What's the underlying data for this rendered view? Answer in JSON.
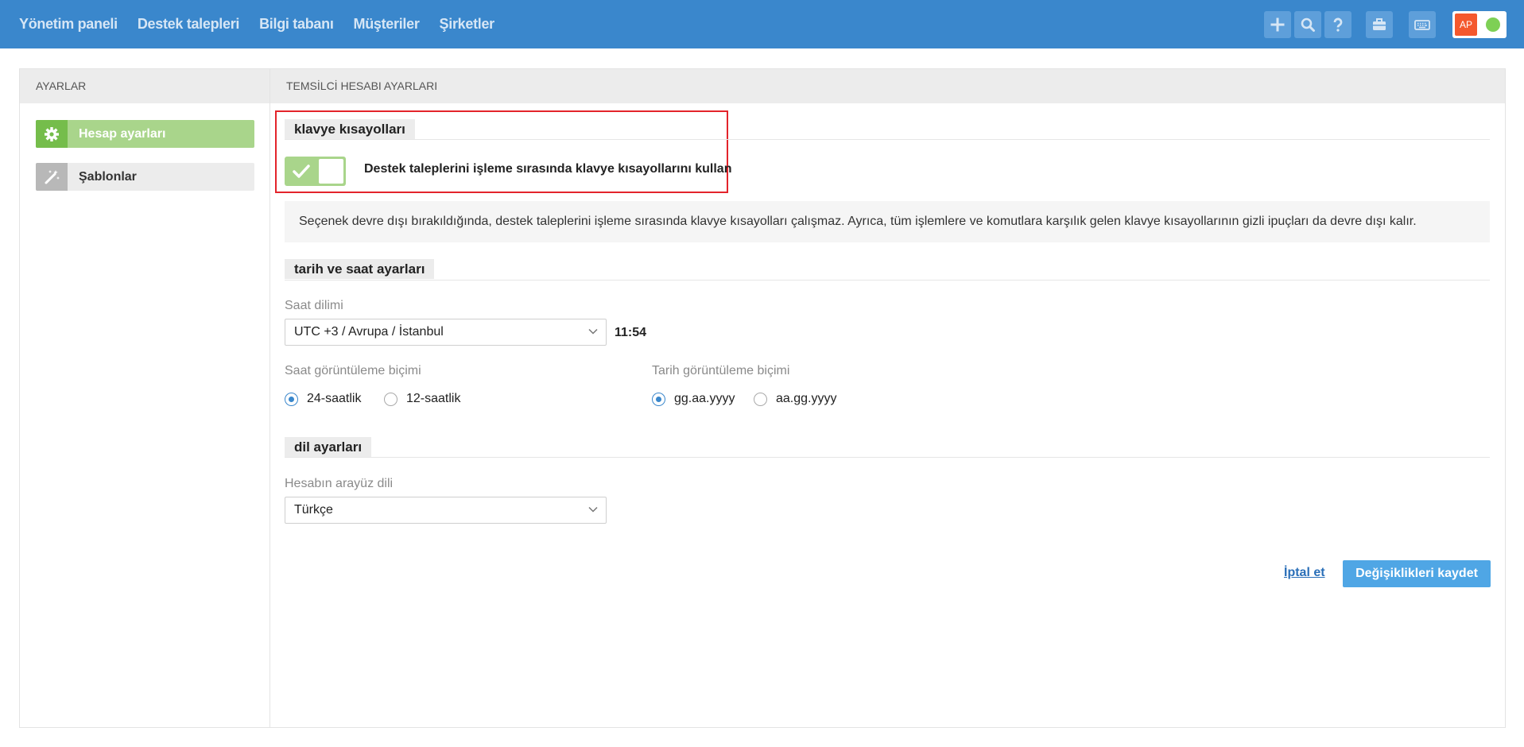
{
  "nav": {
    "items": [
      "Yönetim paneli",
      "Destek talepleri",
      "Bilgi tabanı",
      "Müşteriler",
      "Şirketler"
    ]
  },
  "topbar": {
    "icons": [
      "plus-icon",
      "search-icon",
      "help-icon",
      "briefcase-icon",
      "keyboard-icon"
    ],
    "avatar_initials": "AP",
    "colors": {
      "bar": "#3a87cc",
      "icon_bg": "#5e9fda",
      "avatar": "#f4582d",
      "online": "#7ed055"
    }
  },
  "sidebar": {
    "header": "AYARLAR",
    "items": [
      {
        "label": "Hesap ayarları",
        "icon": "gear-icon",
        "active": true
      },
      {
        "label": "Şablonlar",
        "icon": "magic-wand-icon",
        "active": false
      }
    ]
  },
  "main": {
    "header": "TEMSİLCİ HESABI AYARLARI",
    "shortcuts": {
      "title": "klavye kısayolları",
      "toggle_label": "Destek taleplerini işleme sırasında klavye kısayollarını kullan",
      "enabled": true,
      "info": "Seçenek devre dışı bırakıldığında, destek taleplerini işleme sırasında klavye kısayolları çalışmaz. Ayrıca, tüm işlemlere ve komutlara karşılık gelen klavye kısayollarının gizli ipuçları da devre dışı kalır."
    },
    "datetime": {
      "title": "tarih ve saat ayarları",
      "timezone_label": "Saat dilimi",
      "timezone_value": "UTC +3 / Avrupa / İstanbul",
      "current_time": "11:54",
      "time_format_label": "Saat görüntüleme biçimi",
      "time_formats": [
        {
          "label": "24-saatlik",
          "selected": true
        },
        {
          "label": "12-saatlik",
          "selected": false
        }
      ],
      "date_format_label": "Tarih görüntüleme biçimi",
      "date_formats": [
        {
          "label": "gg.aa.yyyy",
          "selected": true
        },
        {
          "label": "aa.gg.yyyy",
          "selected": false
        }
      ]
    },
    "language": {
      "title": "dil ayarları",
      "label": "Hesabın arayüz dili",
      "value": "Türkçe"
    },
    "actions": {
      "cancel": "İptal et",
      "save": "Değişiklikleri kaydet"
    }
  }
}
